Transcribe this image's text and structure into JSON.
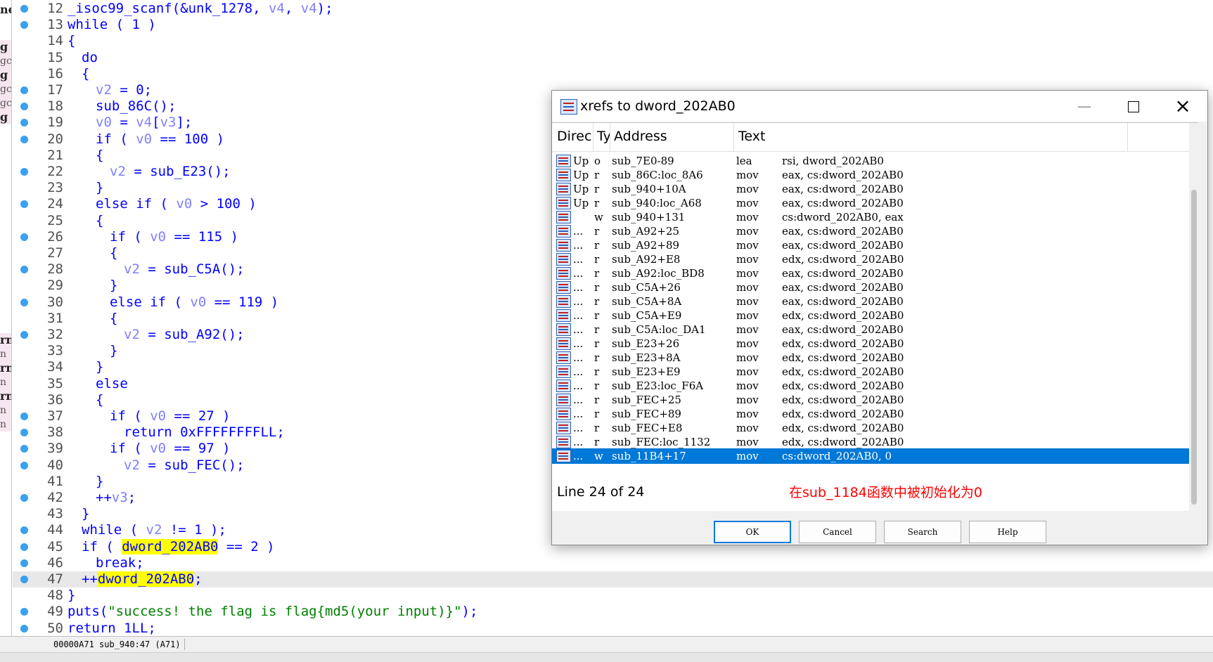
{
  "left_sliver": {
    "items": [
      "ne",
      "g",
      "gc",
      "g",
      "gc",
      "gc",
      "g",
      "rn",
      "n",
      "rn",
      "n",
      "rn",
      "n",
      "n"
    ]
  },
  "code_lines": [
    {
      "num": "12",
      "bp": true,
      "indent": 0,
      "html": "_isoc99_scanf(&unk_1278, <span class='v'>v4</span>, <span class='v'>v4</span>);"
    },
    {
      "num": "13",
      "bp": true,
      "indent": 0,
      "html": "while ( 1 )"
    },
    {
      "num": "14",
      "bp": false,
      "indent": 0,
      "html": "{"
    },
    {
      "num": "15",
      "bp": false,
      "indent": 1,
      "html": "do"
    },
    {
      "num": "16",
      "bp": false,
      "indent": 1,
      "html": "{"
    },
    {
      "num": "17",
      "bp": true,
      "indent": 2,
      "html": "<span class='v'>v2</span> = 0;"
    },
    {
      "num": "18",
      "bp": true,
      "indent": 2,
      "html": "sub_86C();"
    },
    {
      "num": "19",
      "bp": true,
      "indent": 2,
      "html": "<span class='v'>v0</span> = <span class='v'>v4</span>[<span class='v'>v3</span>];"
    },
    {
      "num": "20",
      "bp": true,
      "indent": 2,
      "html": "if ( <span class='v'>v0</span> == 100 )"
    },
    {
      "num": "21",
      "bp": false,
      "indent": 2,
      "html": "{"
    },
    {
      "num": "22",
      "bp": true,
      "indent": 3,
      "html": "<span class='v'>v2</span> = sub_E23();"
    },
    {
      "num": "23",
      "bp": false,
      "indent": 2,
      "html": "}"
    },
    {
      "num": "24",
      "bp": true,
      "indent": 2,
      "html": "else if ( <span class='v'>v0</span> > 100 )"
    },
    {
      "num": "25",
      "bp": false,
      "indent": 2,
      "html": "{"
    },
    {
      "num": "26",
      "bp": true,
      "indent": 3,
      "html": "if ( <span class='v'>v0</span> == 115 )"
    },
    {
      "num": "27",
      "bp": false,
      "indent": 3,
      "html": "{"
    },
    {
      "num": "28",
      "bp": true,
      "indent": 4,
      "html": "<span class='v'>v2</span> = sub_C5A();"
    },
    {
      "num": "29",
      "bp": false,
      "indent": 3,
      "html": "}"
    },
    {
      "num": "30",
      "bp": true,
      "indent": 3,
      "html": "else if ( <span class='v'>v0</span> == 119 )"
    },
    {
      "num": "31",
      "bp": false,
      "indent": 3,
      "html": "{"
    },
    {
      "num": "32",
      "bp": true,
      "indent": 4,
      "html": "<span class='v'>v2</span> = sub_A92();"
    },
    {
      "num": "33",
      "bp": false,
      "indent": 3,
      "html": "}"
    },
    {
      "num": "34",
      "bp": false,
      "indent": 2,
      "html": "}"
    },
    {
      "num": "35",
      "bp": false,
      "indent": 2,
      "html": "else"
    },
    {
      "num": "36",
      "bp": false,
      "indent": 2,
      "html": "{"
    },
    {
      "num": "37",
      "bp": true,
      "indent": 3,
      "html": "if ( <span class='v'>v0</span> == 27 )"
    },
    {
      "num": "38",
      "bp": true,
      "indent": 4,
      "html": "return 0xFFFFFFFFLL;"
    },
    {
      "num": "39",
      "bp": true,
      "indent": 3,
      "html": "if ( <span class='v'>v0</span> == 97 )"
    },
    {
      "num": "40",
      "bp": true,
      "indent": 4,
      "html": "<span class='v'>v2</span> = sub_FEC();"
    },
    {
      "num": "41",
      "bp": false,
      "indent": 2,
      "html": "}"
    },
    {
      "num": "42",
      "bp": true,
      "indent": 2,
      "html": "++<span class='v'>v3</span>;"
    },
    {
      "num": "43",
      "bp": false,
      "indent": 1,
      "html": "}"
    },
    {
      "num": "44",
      "bp": true,
      "indent": 1,
      "html": "while ( <span class='v'>v2</span> != 1 );"
    },
    {
      "num": "45",
      "bp": true,
      "indent": 1,
      "html": "if ( <span class='h'>dword_202AB0</span> == 2 )"
    },
    {
      "num": "46",
      "bp": true,
      "indent": 2,
      "html": "break;"
    },
    {
      "num": "47",
      "bp": true,
      "indent": 1,
      "html": "++<span class='h'>dword_202AB0</span>;",
      "hl": true
    },
    {
      "num": "48",
      "bp": false,
      "indent": 0,
      "html": "}"
    },
    {
      "num": "49",
      "bp": true,
      "indent": 0,
      "html": "puts(<span class='s'>\"success! the flag is flag{md5(your input)}\"</span>);"
    },
    {
      "num": "50",
      "bp": true,
      "indent": 0,
      "html": "return 1LL;"
    }
  ],
  "status_bar": {
    "text": "00000A71 sub_940:47 (A71)"
  },
  "dialog": {
    "title": "xrefs to dword_202AB0",
    "columns": [
      "Direct",
      "Ty",
      "Address",
      "Text"
    ],
    "rows": [
      {
        "dir": "Up",
        "type": "o",
        "address": "sub_7E0-89",
        "mnemonic": "lea",
        "operands": "rsi, dword_202AB0"
      },
      {
        "dir": "Up",
        "type": "r",
        "address": "sub_86C:loc_8A6",
        "mnemonic": "mov",
        "operands": "eax, cs:dword_202AB0"
      },
      {
        "dir": "Up",
        "type": "r",
        "address": "sub_940+10A",
        "mnemonic": "mov",
        "operands": "eax, cs:dword_202AB0"
      },
      {
        "dir": "Up",
        "type": "r",
        "address": "sub_940:loc_A68",
        "mnemonic": "mov",
        "operands": "eax, cs:dword_202AB0"
      },
      {
        "dir": "",
        "type": "w",
        "address": "sub_940+131",
        "mnemonic": "mov",
        "operands": "cs:dword_202AB0, eax"
      },
      {
        "dir": "...",
        "type": "r",
        "address": "sub_A92+25",
        "mnemonic": "mov",
        "operands": "eax, cs:dword_202AB0"
      },
      {
        "dir": "...",
        "type": "r",
        "address": "sub_A92+89",
        "mnemonic": "mov",
        "operands": "eax, cs:dword_202AB0"
      },
      {
        "dir": "...",
        "type": "r",
        "address": "sub_A92+E8",
        "mnemonic": "mov",
        "operands": "edx, cs:dword_202AB0"
      },
      {
        "dir": "...",
        "type": "r",
        "address": "sub_A92:loc_BD8",
        "mnemonic": "mov",
        "operands": "eax, cs:dword_202AB0"
      },
      {
        "dir": "...",
        "type": "r",
        "address": "sub_C5A+26",
        "mnemonic": "mov",
        "operands": "eax, cs:dword_202AB0"
      },
      {
        "dir": "...",
        "type": "r",
        "address": "sub_C5A+8A",
        "mnemonic": "mov",
        "operands": "eax, cs:dword_202AB0"
      },
      {
        "dir": "...",
        "type": "r",
        "address": "sub_C5A+E9",
        "mnemonic": "mov",
        "operands": "edx, cs:dword_202AB0"
      },
      {
        "dir": "...",
        "type": "r",
        "address": "sub_C5A:loc_DA1",
        "mnemonic": "mov",
        "operands": "eax, cs:dword_202AB0"
      },
      {
        "dir": "...",
        "type": "r",
        "address": "sub_E23+26",
        "mnemonic": "mov",
        "operands": "edx, cs:dword_202AB0"
      },
      {
        "dir": "...",
        "type": "r",
        "address": "sub_E23+8A",
        "mnemonic": "mov",
        "operands": "edx, cs:dword_202AB0"
      },
      {
        "dir": "...",
        "type": "r",
        "address": "sub_E23+E9",
        "mnemonic": "mov",
        "operands": "edx, cs:dword_202AB0"
      },
      {
        "dir": "...",
        "type": "r",
        "address": "sub_E23:loc_F6A",
        "mnemonic": "mov",
        "operands": "edx, cs:dword_202AB0"
      },
      {
        "dir": "...",
        "type": "r",
        "address": "sub_FEC+25",
        "mnemonic": "mov",
        "operands": "edx, cs:dword_202AB0"
      },
      {
        "dir": "...",
        "type": "r",
        "address": "sub_FEC+89",
        "mnemonic": "mov",
        "operands": "edx, cs:dword_202AB0"
      },
      {
        "dir": "...",
        "type": "r",
        "address": "sub_FEC+E8",
        "mnemonic": "mov",
        "operands": "edx, cs:dword_202AB0"
      },
      {
        "dir": "...",
        "type": "r",
        "address": "sub_FEC:loc_1132",
        "mnemonic": "mov",
        "operands": "edx, cs:dword_202AB0"
      },
      {
        "dir": "...",
        "type": "w",
        "address": "sub_11B4+17",
        "mnemonic": "mov",
        "operands": "cs:dword_202AB0, 0",
        "selected": true
      }
    ],
    "line_info": "Line 24 of 24",
    "annotation": "在sub_1184函数中被初始化为0",
    "buttons": {
      "ok": "OK",
      "cancel": "Cancel",
      "search": "Search",
      "help": "Help"
    }
  },
  "colors": {
    "selection": "#0078d7",
    "highlight": "#ffff00",
    "breakpoint": "#3aa0f0",
    "annotation": "#ff0000"
  }
}
